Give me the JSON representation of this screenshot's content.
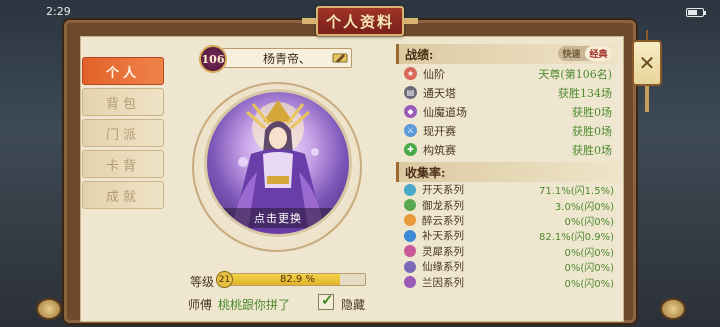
{
  "status": {
    "time": "2:29"
  },
  "window": {
    "title": "个人资料"
  },
  "tabs": [
    {
      "label": "个人",
      "active": true
    },
    {
      "label": "背包",
      "active": false
    },
    {
      "label": "门派",
      "active": false
    },
    {
      "label": "卡背",
      "active": false
    },
    {
      "label": "成就",
      "active": false
    }
  ],
  "profile": {
    "level": "106",
    "name": "杨青帝、",
    "avatar_caption": "点击更换",
    "grade_label": "等级",
    "grade_level": "21",
    "grade_progress_text": "82.9 %",
    "grade_progress": 0.829,
    "master_label": "师傅",
    "master_name": "桃桃跟你拼了",
    "hide_label": "隐藏",
    "hide_checked": true
  },
  "record": {
    "header": "战绩:",
    "toggle": {
      "left": "快速",
      "right": "经典",
      "selected": "经典"
    },
    "rows": [
      {
        "icon": "rank-icon",
        "color": "#d8685a",
        "name": "仙阶",
        "value": "天尊(第106名)"
      },
      {
        "icon": "tower-icon",
        "color": "#6a6a7a",
        "name": "通天塔",
        "value": "获胜134场"
      },
      {
        "icon": "arena-icon",
        "color": "#9a5ab8",
        "name": "仙魔道场",
        "value": "获胜0场"
      },
      {
        "icon": "match-icon",
        "color": "#5a9ad8",
        "name": "现开赛",
        "value": "获胜0场"
      },
      {
        "icon": "build-icon",
        "color": "#4aa84a",
        "name": "构筑赛",
        "value": "获胜0场"
      }
    ]
  },
  "collection": {
    "header": "收集率:",
    "rows": [
      {
        "color": "#4aa8c8",
        "name": "开天系列",
        "value": "71.1%(闪1.5%)"
      },
      {
        "color": "#58a850",
        "name": "御龙系列",
        "value": "3.0%(闪0%)"
      },
      {
        "color": "#e89a3a",
        "name": "醉云系列",
        "value": "0%(闪0%)"
      },
      {
        "color": "#3a8ad8",
        "name": "补天系列",
        "value": "82.1%(闪0.9%)"
      },
      {
        "color": "#c85a9a",
        "name": "灵犀系列",
        "value": "0%(闪0%)"
      },
      {
        "color": "#7a6ab8",
        "name": "仙缘系列",
        "value": "0%(闪0%)"
      },
      {
        "color": "#9a5ab8",
        "name": "兰因系列",
        "value": "0%(闪0%)"
      }
    ]
  }
}
